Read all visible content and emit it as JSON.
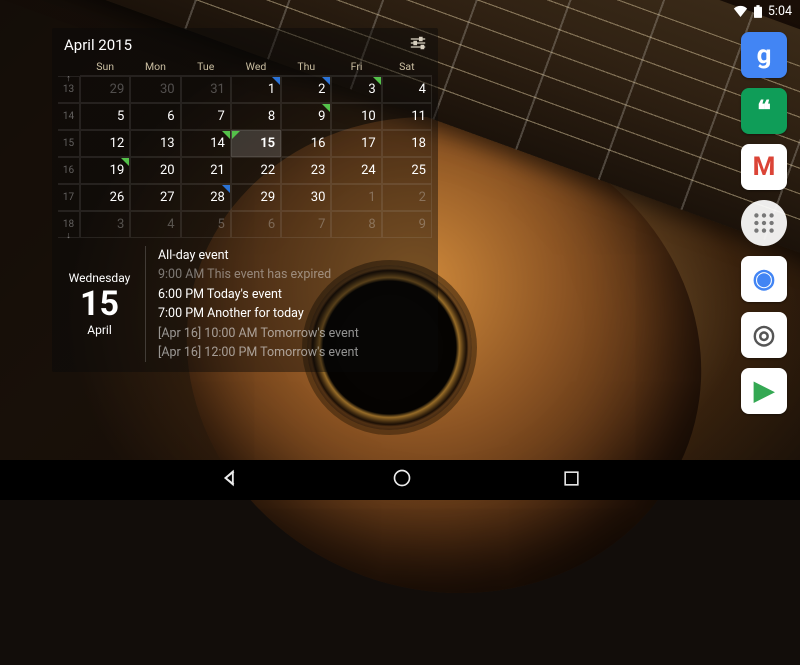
{
  "statusbar": {
    "time": "5:04"
  },
  "dock": {
    "apps": [
      {
        "name": "google",
        "letter": "g",
        "bg": "#4285F4",
        "fg": "#ffffff"
      },
      {
        "name": "hangouts",
        "letter": "❝",
        "bg": "#0F9D58",
        "fg": "#ffffff"
      },
      {
        "name": "gmail",
        "letter": "M",
        "bg": "#ffffff",
        "fg": "#DB4437"
      },
      {
        "name": "chrome",
        "letter": "◉",
        "bg": "#ffffff",
        "fg": "#4285F4"
      },
      {
        "name": "camera",
        "letter": "◎",
        "bg": "#ffffff",
        "fg": "#555555"
      },
      {
        "name": "play",
        "letter": "▶",
        "bg": "#ffffff",
        "fg": "#34A853"
      }
    ]
  },
  "calendar": {
    "title": "April 2015",
    "dow_labels": [
      "Sun",
      "Mon",
      "Tue",
      "Wed",
      "Thu",
      "Fri",
      "Sat"
    ],
    "weeks": [
      {
        "wk": "13",
        "arrow_up": true,
        "days": [
          {
            "n": "29",
            "other": true
          },
          {
            "n": "30",
            "other": true
          },
          {
            "n": "31",
            "other": true
          },
          {
            "n": "1",
            "markers": [
              {
                "corner": "tr",
                "color": "#2b73d6"
              }
            ]
          },
          {
            "n": "2",
            "markers": [
              {
                "corner": "tr",
                "color": "#2b73d6"
              }
            ]
          },
          {
            "n": "3",
            "markers": [
              {
                "corner": "tr",
                "color": "#54c14a"
              }
            ]
          },
          {
            "n": "4"
          }
        ]
      },
      {
        "wk": "14",
        "days": [
          {
            "n": "5"
          },
          {
            "n": "6"
          },
          {
            "n": "7"
          },
          {
            "n": "8"
          },
          {
            "n": "9",
            "markers": [
              {
                "corner": "tr",
                "color": "#54c14a"
              }
            ]
          },
          {
            "n": "10"
          },
          {
            "n": "11"
          }
        ]
      },
      {
        "wk": "15",
        "days": [
          {
            "n": "12"
          },
          {
            "n": "13"
          },
          {
            "n": "14",
            "markers": [
              {
                "corner": "tr",
                "color": "#54c14a"
              }
            ]
          },
          {
            "n": "15",
            "today": true,
            "markers": [
              {
                "corner": "tl",
                "color": "#54c14a"
              }
            ]
          },
          {
            "n": "16"
          },
          {
            "n": "17"
          },
          {
            "n": "18"
          }
        ]
      },
      {
        "wk": "16",
        "days": [
          {
            "n": "19",
            "markers": [
              {
                "corner": "tr",
                "color": "#54c14a"
              }
            ]
          },
          {
            "n": "20"
          },
          {
            "n": "21"
          },
          {
            "n": "22"
          },
          {
            "n": "23"
          },
          {
            "n": "24"
          },
          {
            "n": "25"
          }
        ]
      },
      {
        "wk": "17",
        "days": [
          {
            "n": "26"
          },
          {
            "n": "27"
          },
          {
            "n": "28",
            "markers": [
              {
                "corner": "tr",
                "color": "#2b73d6"
              }
            ]
          },
          {
            "n": "29"
          },
          {
            "n": "30"
          },
          {
            "n": "1",
            "other": true
          },
          {
            "n": "2",
            "other": true
          }
        ]
      },
      {
        "wk": "18",
        "arrow_down": true,
        "days": [
          {
            "n": "3",
            "other": true
          },
          {
            "n": "4",
            "other": true
          },
          {
            "n": "5",
            "other": true
          },
          {
            "n": "6",
            "other": true
          },
          {
            "n": "7",
            "other": true
          },
          {
            "n": "8",
            "other": true
          },
          {
            "n": "9",
            "other": true
          }
        ]
      }
    ]
  },
  "agenda": {
    "weekday": "Wednesday",
    "daynum": "15",
    "month": "April",
    "events": [
      {
        "text": "All-day event",
        "class": ""
      },
      {
        "text": "9:00 AM This event has expired",
        "class": "ev-dim"
      },
      {
        "text": "6:00 PM Today's event",
        "class": ""
      },
      {
        "text": "7:00 PM Another for today",
        "class": ""
      },
      {
        "text": "[Apr 16] 10:00 AM Tomorrow's event",
        "class": "ev-med"
      },
      {
        "text": "[Apr 16] 12:00 PM Tomorrow's event",
        "class": "ev-med"
      }
    ]
  }
}
